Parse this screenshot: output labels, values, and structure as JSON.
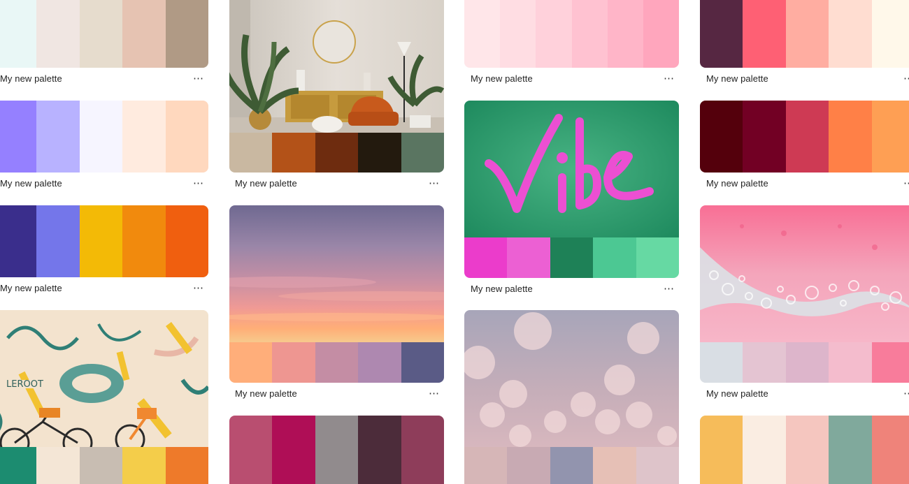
{
  "palette_label": "My new palette",
  "more_icon": "⋯",
  "columns": [
    {
      "cards": [
        {
          "type": "colors",
          "colors": [
            "#E9F7F6",
            "#F0E6E2",
            "#E6DCCD",
            "#E6C3B2",
            "#B09A85"
          ]
        },
        {
          "type": "colors",
          "colors": [
            "#9580FF",
            "#B8B2FF",
            "#F6F5FF",
            "#FFEBDF",
            "#FFD8BE"
          ]
        },
        {
          "type": "colors",
          "colors": [
            "#3A2E8C",
            "#7476EA",
            "#F3BA06",
            "#F18A0D",
            "#F05F0F"
          ]
        },
        {
          "type": "photo",
          "image": "bike-mural",
          "colors": [
            "#1C8C70",
            "#F4E6D6",
            "#C8BDB2",
            "#F4CD4A",
            "#EE7A2A"
          ]
        }
      ]
    },
    {
      "cards": [
        {
          "type": "photo",
          "image": "living-room",
          "colors": [
            "#C9B8A1",
            "#B35218",
            "#6E2C0F",
            "#231A0E",
            "#5A7561"
          ]
        },
        {
          "type": "photo",
          "image": "sunset-sky",
          "colors": [
            "#FFAE7A",
            "#EE9691",
            "#C48DA4",
            "#AE88B0",
            "#5A5B86"
          ]
        },
        {
          "type": "colors",
          "colors": [
            "#B94E70",
            "#AF0E56",
            "#918B8D",
            "#4C2C3A",
            "#8E3D5A"
          ]
        }
      ]
    },
    {
      "cards": [
        {
          "type": "colors",
          "colors": [
            "#FFE6E9",
            "#FFDDE3",
            "#FFD1DB",
            "#FFC2D1",
            "#FFB5C8",
            "#FFA6BD"
          ]
        },
        {
          "type": "photo",
          "image": "vibe-neon",
          "colors": [
            "#EB3CCB",
            "#EC60D3",
            "#1E8157",
            "#4CC893",
            "#66D9A3"
          ]
        },
        {
          "type": "photo",
          "image": "bokeh",
          "colors": [
            "#D6B6B7",
            "#C8AAB3",
            "#9294AE",
            "#E6C0B6",
            "#DEC4CA"
          ]
        }
      ]
    },
    {
      "cards": [
        {
          "type": "colors",
          "colors": [
            "#562742",
            "#FE6074",
            "#FFADA1",
            "#FFDDD1",
            "#FFF8EA"
          ]
        },
        {
          "type": "colors",
          "colors": [
            "#54000C",
            "#720024",
            "#CE3A54",
            "#FF8047",
            "#FE9F54"
          ]
        },
        {
          "type": "photo",
          "image": "pink-bubbles",
          "colors": [
            "#D9DEE4",
            "#E4C4D2",
            "#DDB5CB",
            "#F4BCCD",
            "#F87C9B"
          ]
        },
        {
          "type": "colors",
          "colors": [
            "#F6BC5A",
            "#FAEDE2",
            "#F5C6BF",
            "#80A99C",
            "#EF837A"
          ]
        }
      ]
    }
  ]
}
